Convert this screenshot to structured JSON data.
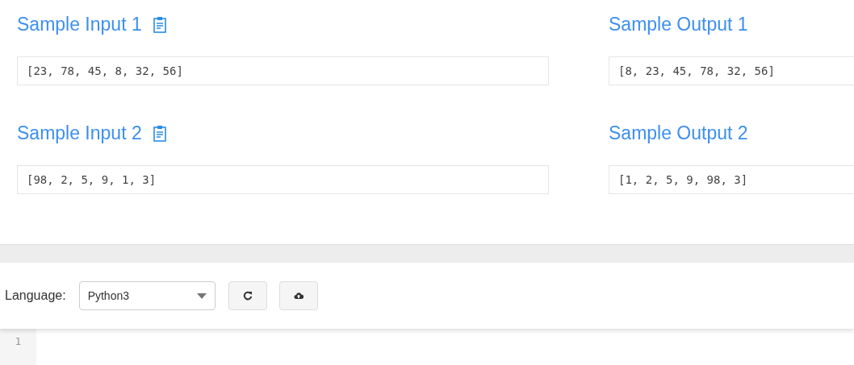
{
  "samples": [
    {
      "input": {
        "title": "Sample Input 1",
        "value": "[23, 78, 45, 8, 32, 56]"
      },
      "output": {
        "title": "Sample Output 1",
        "value": "[8, 23, 45, 78, 32, 56]"
      }
    },
    {
      "input": {
        "title": "Sample Input 2",
        "value": "[98, 2, 5, 9, 1, 3]"
      },
      "output": {
        "title": "Sample Output 2",
        "value": "[1, 2, 5, 9, 98, 3]"
      }
    }
  ],
  "toolbar": {
    "language_label": "Language:",
    "language": "Python3"
  },
  "editor": {
    "line_numbers": [
      "1"
    ]
  }
}
